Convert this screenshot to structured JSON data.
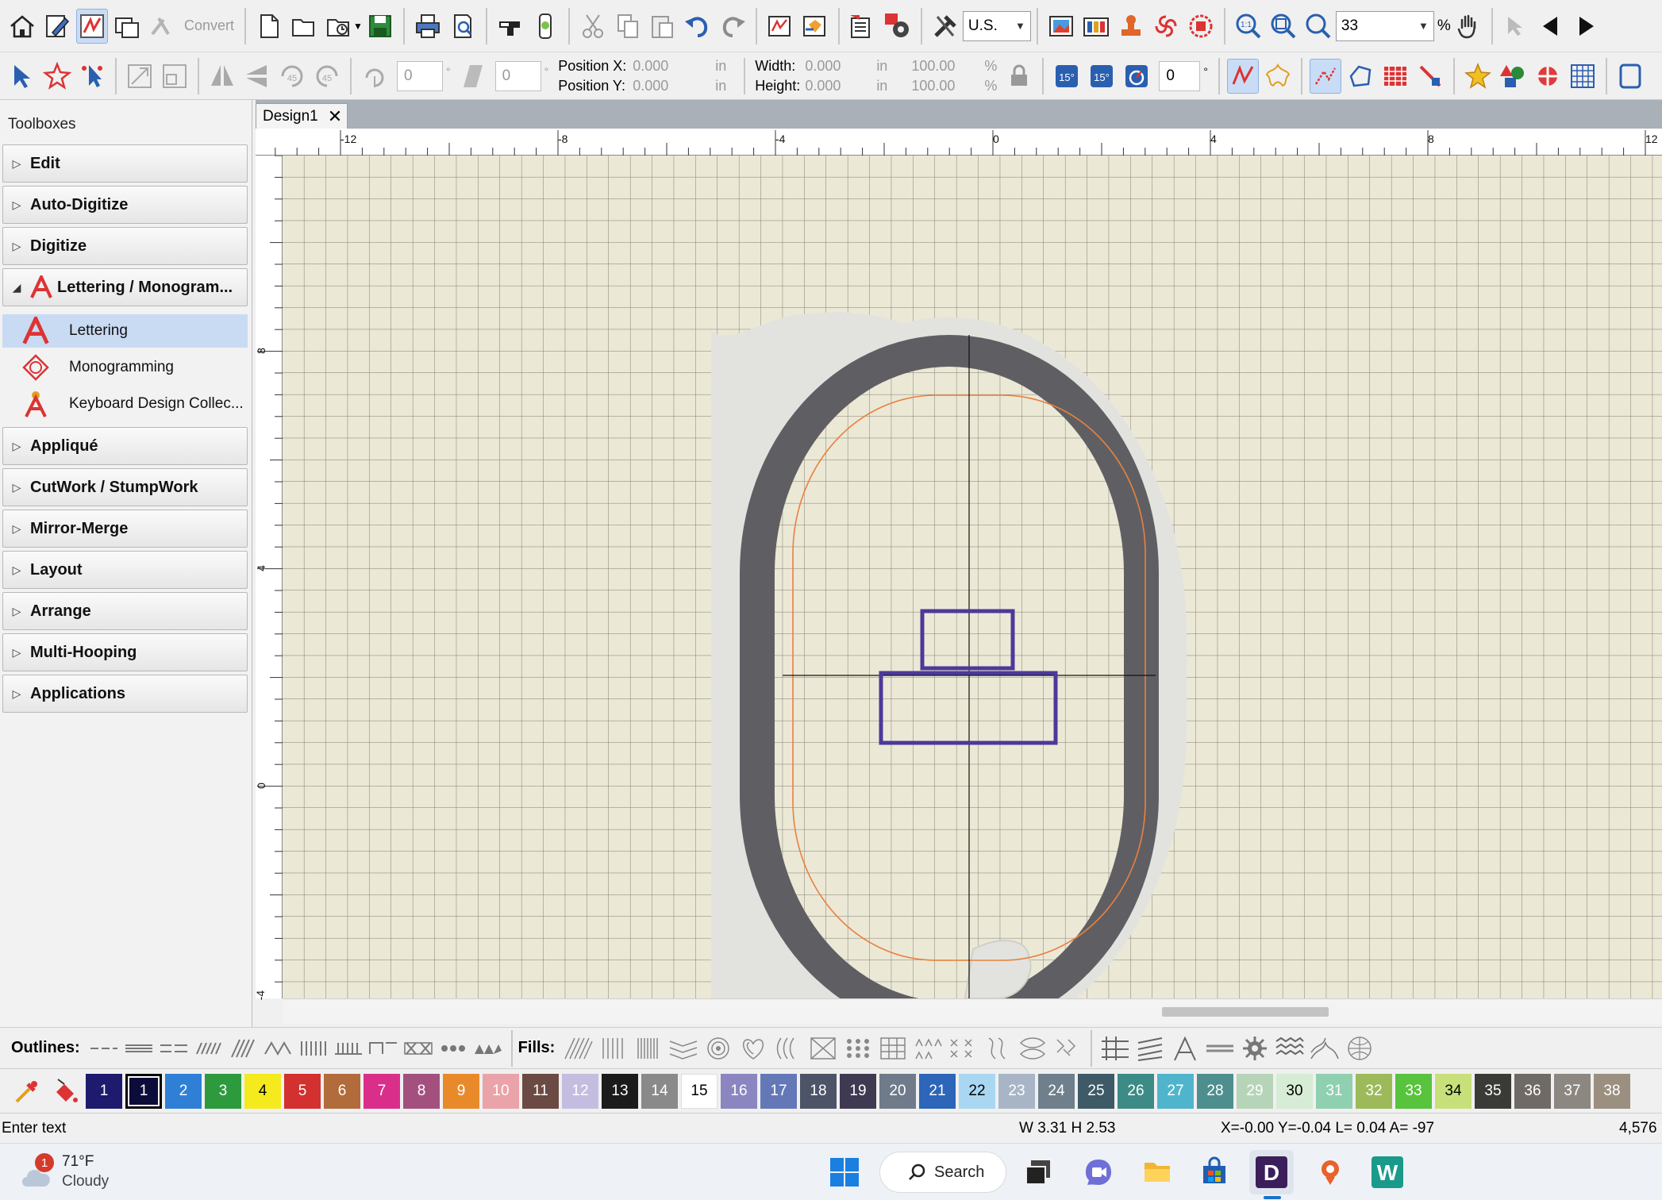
{
  "toolbar1": {
    "convert_label": "Convert",
    "units_value": "U.S.",
    "zoom_value": "33",
    "zoom_unit": "%"
  },
  "toolbar2": {
    "rotate_value": "0",
    "rotate_unit": "°",
    "slant_value": "0",
    "slant_unit": "°",
    "position_x_label": "Position X:",
    "position_x_value": "0.000",
    "position_x_unit": "in",
    "position_y_label": "Position Y:",
    "position_y_value": "0.000",
    "position_y_unit": "in",
    "width_label": "Width:",
    "width_value": "0.000",
    "width_unit": "in",
    "width_percent": "100.00",
    "height_label": "Height:",
    "height_value": "0.000",
    "height_unit": "in",
    "height_percent": "100.00",
    "percent_unit": "%",
    "angle_value": "0",
    "angle_unit": "°"
  },
  "sidebar": {
    "title": "Toolboxes",
    "sections": {
      "edit": "Edit",
      "auto_digitize": "Auto-Digitize",
      "digitize": "Digitize",
      "lettering": "Lettering / Monogram...",
      "applique": "Appliqué",
      "cutwork": "CutWork / StumpWork",
      "mirror_merge": "Mirror-Merge",
      "layout": "Layout",
      "arrange": "Arrange",
      "multi_hooping": "Multi-Hooping",
      "applications": "Applications"
    },
    "lettering_items": {
      "lettering": "Lettering",
      "monogramming": "Monogramming",
      "keyboard": "Keyboard Design Collec..."
    }
  },
  "document": {
    "tab_label": "Design1",
    "hruler_labels": [
      "-12",
      "-8",
      "-4",
      "0",
      "4",
      "8",
      "12"
    ],
    "vruler_labels": [
      "8",
      "4",
      "0",
      "-4"
    ]
  },
  "outlines_label": "Outlines:",
  "fills_label": "Fills:",
  "palette": [
    {
      "n": "1",
      "bg": "#1e1a6e",
      "fg": "#ffffff"
    },
    {
      "n": "1",
      "bg": "#0c0c3a",
      "fg": "#ffffff"
    },
    {
      "n": "2",
      "bg": "#2f7fd6",
      "fg": "#ffffff"
    },
    {
      "n": "3",
      "bg": "#2d9a3e",
      "fg": "#ffffff"
    },
    {
      "n": "4",
      "bg": "#f4ea1e",
      "fg": "#000000"
    },
    {
      "n": "5",
      "bg": "#d33030",
      "fg": "#ffffff"
    },
    {
      "n": "6",
      "bg": "#b26b3b",
      "fg": "#ffffff"
    },
    {
      "n": "7",
      "bg": "#d92f8a",
      "fg": "#ffffff"
    },
    {
      "n": "8",
      "bg": "#a3507e",
      "fg": "#ffffff"
    },
    {
      "n": "9",
      "bg": "#e98a2a",
      "fg": "#ffffff"
    },
    {
      "n": "10",
      "bg": "#eaa3a8",
      "fg": "#ffffff"
    },
    {
      "n": "11",
      "bg": "#6b4a44",
      "fg": "#ffffff"
    },
    {
      "n": "12",
      "bg": "#c5bde0",
      "fg": "#ffffff"
    },
    {
      "n": "13",
      "bg": "#1b1b1b",
      "fg": "#ffffff"
    },
    {
      "n": "14",
      "bg": "#8a8a8a",
      "fg": "#ffffff"
    },
    {
      "n": "15",
      "bg": "#ffffff",
      "fg": "#000000"
    },
    {
      "n": "16",
      "bg": "#8c86c0",
      "fg": "#ffffff"
    },
    {
      "n": "17",
      "bg": "#6478b8",
      "fg": "#ffffff"
    },
    {
      "n": "18",
      "bg": "#4e5468",
      "fg": "#ffffff"
    },
    {
      "n": "19",
      "bg": "#3f3a52",
      "fg": "#ffffff"
    },
    {
      "n": "20",
      "bg": "#6f7a8a",
      "fg": "#ffffff"
    },
    {
      "n": "21",
      "bg": "#2d65b8",
      "fg": "#ffffff"
    },
    {
      "n": "22",
      "bg": "#a9d7f2",
      "fg": "#000000"
    },
    {
      "n": "23",
      "bg": "#a8b5c6",
      "fg": "#ffffff"
    },
    {
      "n": "24",
      "bg": "#6f7f8c",
      "fg": "#ffffff"
    },
    {
      "n": "25",
      "bg": "#3d5a66",
      "fg": "#ffffff"
    },
    {
      "n": "26",
      "bg": "#3c8b86",
      "fg": "#ffffff"
    },
    {
      "n": "27",
      "bg": "#50b5cc",
      "fg": "#ffffff"
    },
    {
      "n": "28",
      "bg": "#4f8e8e",
      "fg": "#ffffff"
    },
    {
      "n": "29",
      "bg": "#b6d4b8",
      "fg": "#ffffff"
    },
    {
      "n": "30",
      "bg": "#d6ecd4",
      "fg": "#000000"
    },
    {
      "n": "31",
      "bg": "#8fd0b0",
      "fg": "#ffffff"
    },
    {
      "n": "32",
      "bg": "#9cba5a",
      "fg": "#ffffff"
    },
    {
      "n": "33",
      "bg": "#58c33c",
      "fg": "#ffffff"
    },
    {
      "n": "34",
      "bg": "#c8e07a",
      "fg": "#000000"
    },
    {
      "n": "35",
      "bg": "#3a3a36",
      "fg": "#ffffff"
    },
    {
      "n": "36",
      "bg": "#6f6a66",
      "fg": "#ffffff"
    },
    {
      "n": "37",
      "bg": "#8c8780",
      "fg": "#ffffff"
    },
    {
      "n": "38",
      "bg": "#9b8f80",
      "fg": "#ffffff"
    }
  ],
  "status": {
    "message": "Enter text",
    "size": "W 3.31 H 2.53",
    "coords": "X=-0.00 Y=-0.04 L= 0.04 A= -97",
    "stitches": "4,576"
  },
  "taskbar": {
    "weather_badge": "1",
    "weather_temp": "71°F",
    "weather_desc": "Cloudy",
    "search_label": "Search"
  },
  "colors": {
    "grid_bg": "#ece8d6",
    "hoop_dark": "#5f5f63",
    "hoop_light": "#e2e3df",
    "design_outline": "#4b3a99",
    "sew_area": "#e8813f",
    "selection_blue": "#c9daf3"
  }
}
